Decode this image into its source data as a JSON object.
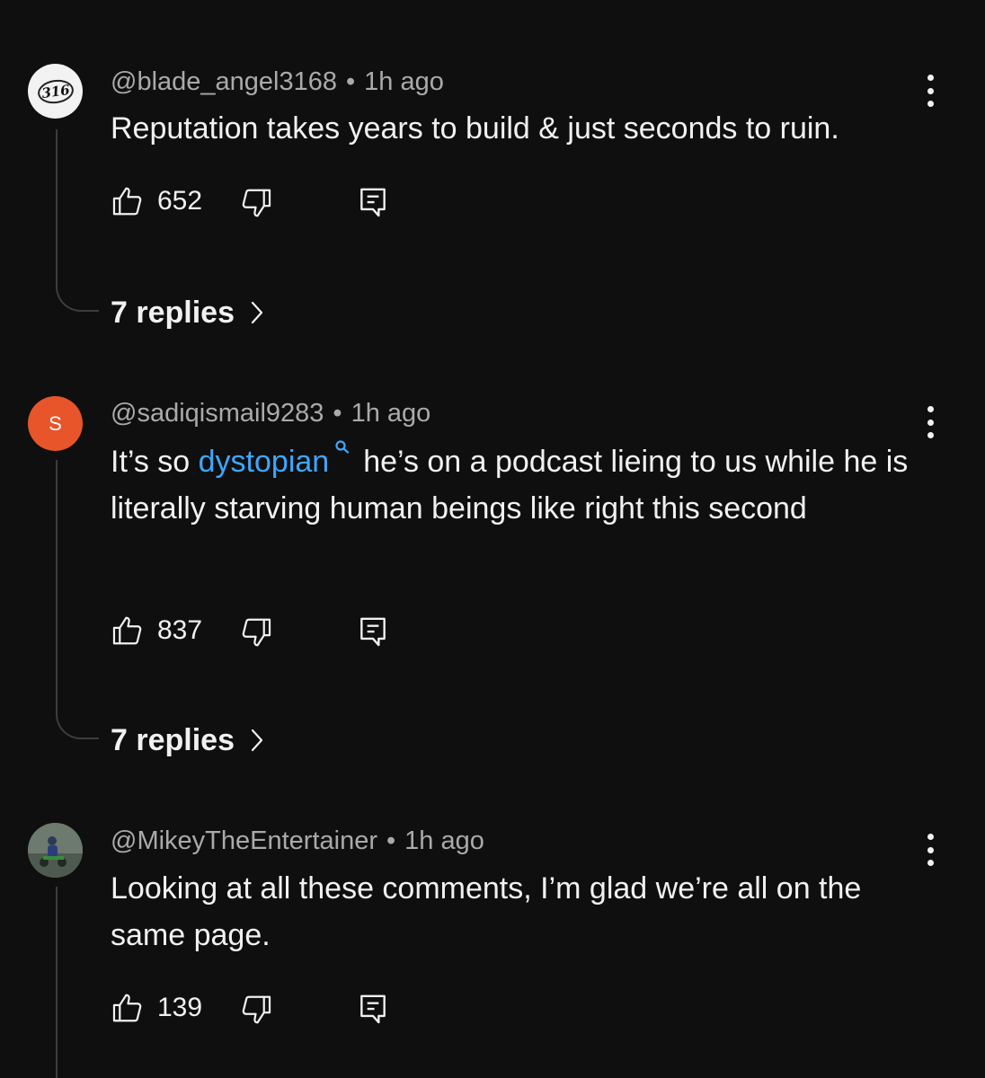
{
  "comments": [
    {
      "handle": "@blade_angel3168",
      "time": "1h ago",
      "avatar_text": "316",
      "text_plain": "Reputation takes years to build & just seconds to ruin.",
      "likes": "652",
      "replies": "7 replies"
    },
    {
      "handle": "@sadiqismail9283",
      "time": "1h ago",
      "avatar_text": "S",
      "text_before": "It’s so ",
      "link_text": "dystopian",
      "text_after": "he’s on a podcast lieing to us while he is literally starving human beings like right this second",
      "likes": "837",
      "replies": "7 replies"
    },
    {
      "handle": "@MikeyTheEntertainer",
      "time": "1h ago",
      "text_plain": "Looking at all these comments, I’m glad we’re all on the same page.",
      "likes": "139"
    }
  ],
  "ui": {
    "separator": "•"
  },
  "icons": {
    "like": "thumbs-up-icon",
    "dislike": "thumbs-down-icon",
    "reply": "comment-reply-icon",
    "more": "more-vertical-icon",
    "search_link": "search-icon",
    "chevron": "chevron-right-icon"
  },
  "colors": {
    "background": "#0f0f0f",
    "text": "#f1f1f1",
    "meta": "#aaaaaa",
    "link": "#3ea6ff",
    "avatar_s": "#e8552a"
  }
}
